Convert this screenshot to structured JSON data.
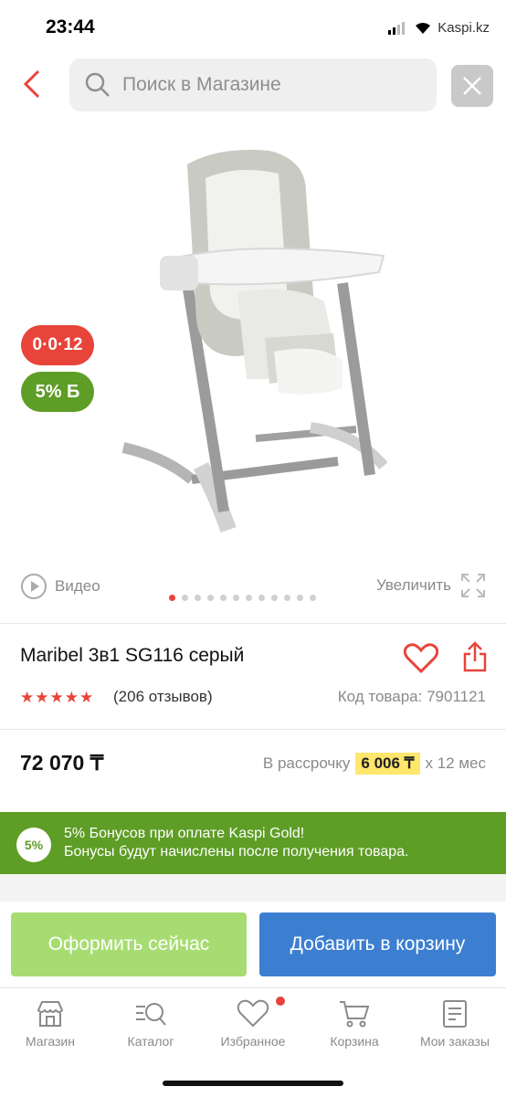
{
  "status_bar": {
    "time": "23:44",
    "carrier": "Kaspi.kz"
  },
  "header": {
    "search_placeholder": "Поиск в Магазине"
  },
  "product": {
    "badges": {
      "installment": "0·0·12",
      "bonus": "5% Б"
    },
    "video_label": "Видео",
    "zoom_label": "Увеличить",
    "gallery": {
      "total": 12,
      "active": 1
    },
    "title": "Maribel 3в1 SG116 серый",
    "rating": 5,
    "reviews": "(206 отзывов)",
    "code": "Код товара: 7901121",
    "price": "72 070 ₸",
    "installment_prefix": "В рассрочку",
    "installment_amount": "6 006 ₸",
    "installment_suffix": "x 12 мес"
  },
  "bonus": {
    "circle": "5%",
    "line1": "5% Бонусов при оплате Kaspi Gold!",
    "line2": "Бонусы будут начислены после получения товара."
  },
  "actions": {
    "buy_now": "Оформить сейчас",
    "add_to_cart": "Добавить в корзину"
  },
  "colors": {
    "accent_red": "#e8443a",
    "bonus_green": "#5e9d26",
    "cart_blue": "#3c7fd1",
    "buy_green": "#a7dc72"
  },
  "bottom_nav": [
    {
      "label": "Магазин",
      "icon": "store-icon"
    },
    {
      "label": "Каталог",
      "icon": "catalog-search-icon"
    },
    {
      "label": "Избранное",
      "icon": "heart-icon"
    },
    {
      "label": "Корзина",
      "icon": "cart-icon"
    },
    {
      "label": "Мои заказы",
      "icon": "orders-icon"
    }
  ]
}
